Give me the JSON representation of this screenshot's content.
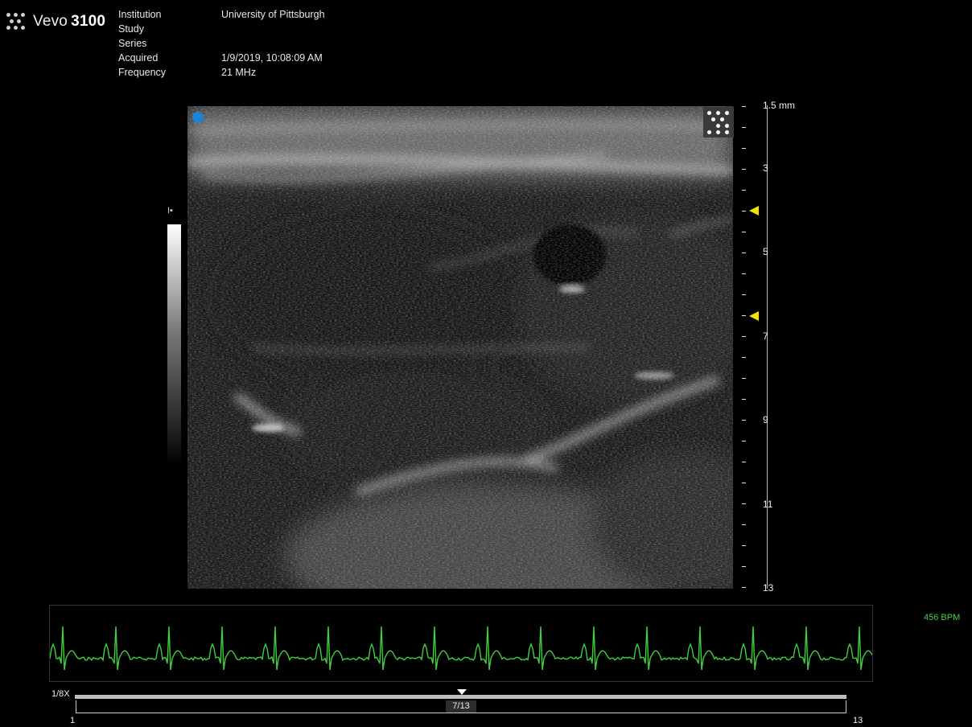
{
  "app": {
    "brand": "Vevo",
    "model": "3100"
  },
  "info": {
    "labels": [
      "Institution",
      "Study",
      "Series",
      "Acquired",
      "Frequency"
    ],
    "values": [
      "University of Pittsburgh",
      "",
      "",
      "1/9/2019, 10:08:09 AM",
      "21 MHz"
    ]
  },
  "depth_axis": {
    "labels": [
      "1.5 mm",
      "3",
      "5",
      "7",
      "9",
      "11",
      "13"
    ],
    "focus_markers": 2
  },
  "ecg": {
    "bpm": "456 BPM",
    "trace_color": "#3ecf3e"
  },
  "playback": {
    "speed": "1/8X",
    "current_frame": "7/13",
    "range_start": "1",
    "range_end": "13"
  },
  "colors": {
    "probe_indicator": "#1c84d6",
    "focus_marker": "#f2e400"
  },
  "icons": {
    "logo": "vevo-dots-logo",
    "layout_toggle": "grid-dots-icon",
    "grayscale": "grayscale-map-icon"
  }
}
